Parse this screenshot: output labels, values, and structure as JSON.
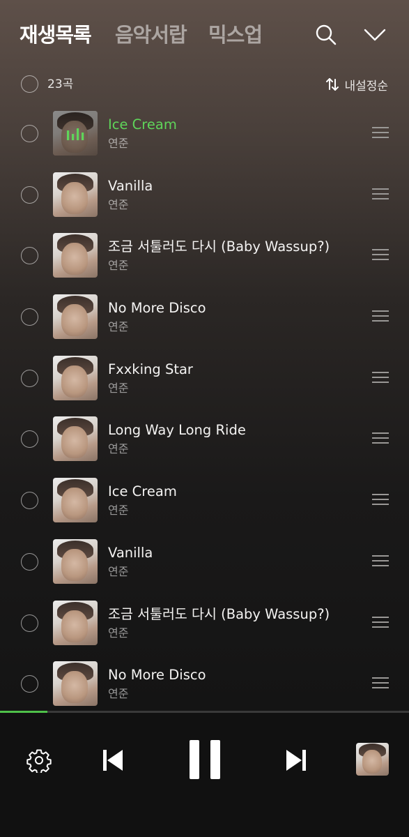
{
  "header": {
    "tabs": [
      {
        "label": "재생목록",
        "active": true
      },
      {
        "label": "음악서랍",
        "active": false
      },
      {
        "label": "믹스업",
        "active": false
      }
    ],
    "icons": [
      "search-icon",
      "chevron-down-icon"
    ]
  },
  "list_header": {
    "count": "23곡",
    "sort_label": "내설정순",
    "sort_icon": "sort-arrows-icon"
  },
  "songs": [
    {
      "title": "Ice Cream",
      "artist": "연준",
      "now_playing": true
    },
    {
      "title": "Vanilla",
      "artist": "연준"
    },
    {
      "title": "조금 서툴러도 다시 (Baby Wassup?)",
      "artist": "연준"
    },
    {
      "title": "No More Disco",
      "artist": "연준"
    },
    {
      "title": "Fxxking Star",
      "artist": "연준"
    },
    {
      "title": "Long Way Long Ride",
      "artist": "연준"
    },
    {
      "title": "Ice Cream",
      "artist": "연준"
    },
    {
      "title": "Vanilla",
      "artist": "연준"
    },
    {
      "title": "조금 서툴러도 다시 (Baby Wassup?)",
      "artist": "연준"
    },
    {
      "title": "No More Disco",
      "artist": "연준"
    }
  ],
  "player": {
    "progress": 0.115,
    "icons": [
      "gear-icon",
      "skip-previous-icon",
      "pause-icon",
      "skip-next-icon"
    ]
  },
  "colors": {
    "accent": "#5fd55a",
    "progress": "#4fc04a",
    "background": "#111111"
  }
}
